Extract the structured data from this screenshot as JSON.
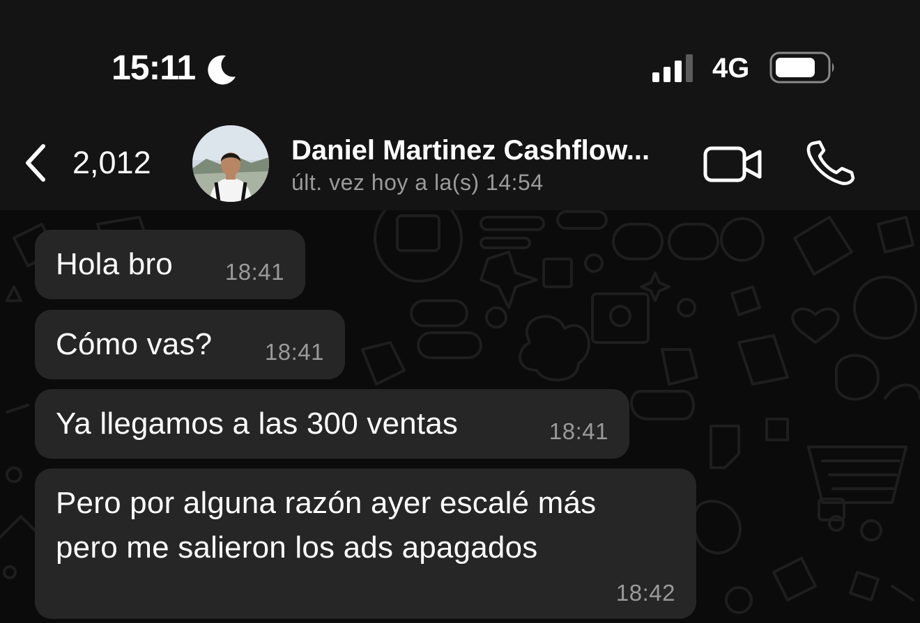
{
  "status_bar": {
    "time": "15:11",
    "network": "4G",
    "icons": [
      "moon-icon",
      "cellular-signal-icon",
      "battery-icon"
    ]
  },
  "header": {
    "back_count": "2,012",
    "contact_name": "Daniel Martinez Cashflow...",
    "last_seen": "últ. vez hoy a la(s) 14:54",
    "icons": [
      "back-chevron-icon",
      "video-camera-icon",
      "phone-icon"
    ]
  },
  "messages": [
    {
      "text": "Hola bro",
      "time": "18:41"
    },
    {
      "text": "Cómo vas?",
      "time": "18:41"
    },
    {
      "text": "Ya llegamos a las 300 ventas",
      "time": "18:41"
    },
    {
      "text_line1": "Pero por alguna razón ayer escalé más",
      "text_line2": "pero me salieron los ads apagados",
      "time": "18:42"
    }
  ],
  "colors": {
    "background": "#0b0b0b",
    "header": "#141414",
    "bubble": "#262626",
    "secondary_text": "#9b9b9b"
  }
}
